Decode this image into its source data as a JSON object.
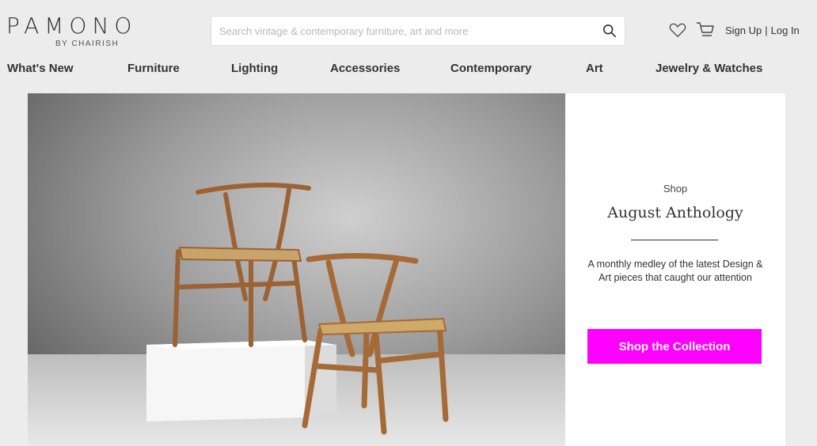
{
  "header": {
    "logo_text": "PAMONO",
    "logo_sub": "BY CHAIRISH",
    "search_placeholder": "Search vintage & contemporary furniture, art and more",
    "account": {
      "signup": "Sign Up",
      "separator": "|",
      "login": "Log In"
    }
  },
  "nav": [
    {
      "label": "What's New"
    },
    {
      "label": "Furniture"
    },
    {
      "label": "Lighting"
    },
    {
      "label": "Accessories"
    },
    {
      "label": "Contemporary"
    },
    {
      "label": "Art"
    },
    {
      "label": "Jewelry & Watches"
    }
  ],
  "hero": {
    "image_subject": "two-wishbone-chairs-on-white-plinth",
    "eyebrow": "Shop",
    "title": "August Anthology",
    "description": "A monthly medley of the latest Design & Art pieces that caught our attention",
    "cta": "Shop the Collection",
    "cta_color": "#ff00ff"
  },
  "icons": [
    "search-icon",
    "heart-icon",
    "cart-icon"
  ]
}
